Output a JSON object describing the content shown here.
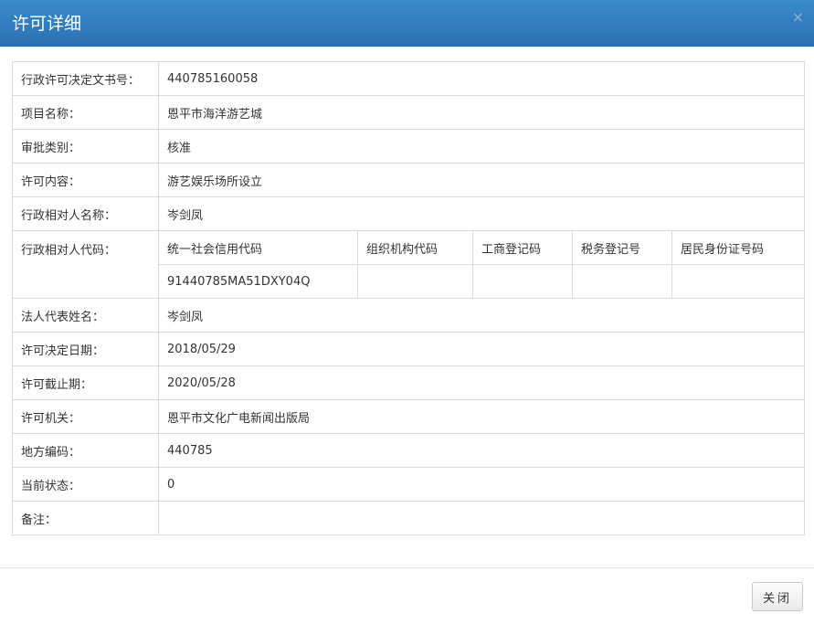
{
  "dialog": {
    "title": "许可详细",
    "close_icon": "×",
    "close_button": "关闭"
  },
  "rows": {
    "doc_no": {
      "label": "行政许可决定文书号：",
      "value": "440785160058"
    },
    "project": {
      "label": "项目名称：",
      "value": "恩平市海洋游艺城"
    },
    "approval_type": {
      "label": "审批类别：",
      "value": "核准"
    },
    "content": {
      "label": "许可内容：",
      "value": "游艺娱乐场所设立"
    },
    "party_name": {
      "label": "行政相对人名称：",
      "value": "岑剑凤"
    },
    "party_code": {
      "label": "行政相对人代码：",
      "headers": [
        "统一社会信用代码",
        "组织机构代码",
        "工商登记码",
        "税务登记号",
        "居民身份证号码"
      ],
      "values": [
        "91440785MA51DXY04Q",
        "",
        "",
        "",
        ""
      ]
    },
    "legal_rep": {
      "label": "法人代表姓名：",
      "value": "岑剑凤"
    },
    "decision_date": {
      "label": "许可决定日期：",
      "value": "2018/05/29"
    },
    "expiry_date": {
      "label": "许可截止期：",
      "value": "2020/05/28"
    },
    "authority": {
      "label": "许可机关：",
      "value": "恩平市文化广电新闻出版局"
    },
    "area_code": {
      "label": "地方编码：",
      "value": "440785"
    },
    "status": {
      "label": "当前状态：",
      "value": "0"
    },
    "remark": {
      "label": "备注：",
      "value": ""
    }
  }
}
